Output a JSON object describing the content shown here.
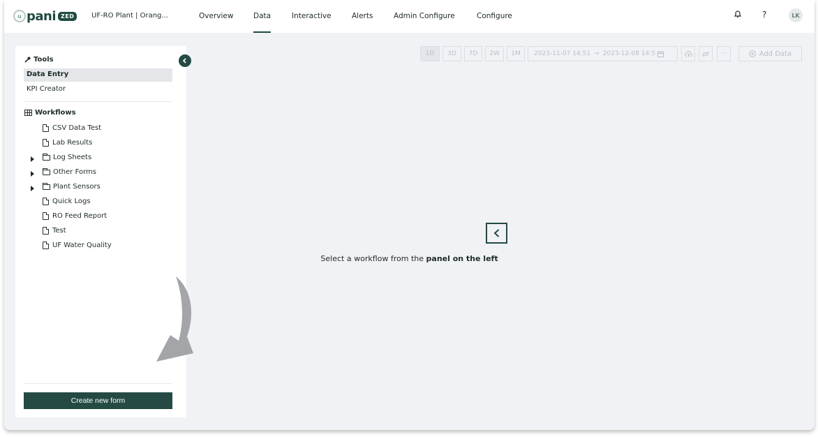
{
  "logo": {
    "mark": "u",
    "word": "pani",
    "badge": "ZED"
  },
  "header": {
    "plant": "UF-RO Plant | Orang...",
    "nav": [
      {
        "label": "Overview",
        "active": false
      },
      {
        "label": "Data",
        "active": true
      },
      {
        "label": "Interactive",
        "active": false
      },
      {
        "label": "Alerts",
        "active": false
      },
      {
        "label": "Admin Configure",
        "active": false
      },
      {
        "label": "Configure",
        "active": false
      }
    ],
    "help": "?",
    "avatar_initials": "LK"
  },
  "tools": {
    "title": "Tools",
    "items": [
      {
        "label": "Data Entry",
        "selected": true
      },
      {
        "label": "KPI Creator",
        "selected": false
      }
    ]
  },
  "workflows": {
    "title": "Workflows",
    "items": [
      {
        "label": "CSV Data Test",
        "type": "file"
      },
      {
        "label": "Lab Results",
        "type": "file"
      },
      {
        "label": "Log Sheets",
        "type": "folder"
      },
      {
        "label": "Other Forms",
        "type": "folder"
      },
      {
        "label": "Plant Sensors",
        "type": "folder"
      },
      {
        "label": "Quick Logs",
        "type": "file"
      },
      {
        "label": "RO Feed Report",
        "type": "file"
      },
      {
        "label": "Test",
        "type": "file"
      },
      {
        "label": "UF Water Quality",
        "type": "file"
      }
    ]
  },
  "create_button": "Create new form",
  "toolbar": {
    "ranges": [
      "1D",
      "3D",
      "7D",
      "2W",
      "1M"
    ],
    "selected_range": "1D",
    "date_start": "2023-11-07 14:51",
    "date_end": "2023-12-08 14:5",
    "arrow": "→",
    "more": "···",
    "add_data": "Add Data"
  },
  "empty_state": {
    "prefix": "Select a workflow from the ",
    "bold": "panel on the left"
  },
  "colors": {
    "brand": "#244a43",
    "background": "#f1f2f5",
    "disabled": "#b9bec6"
  }
}
